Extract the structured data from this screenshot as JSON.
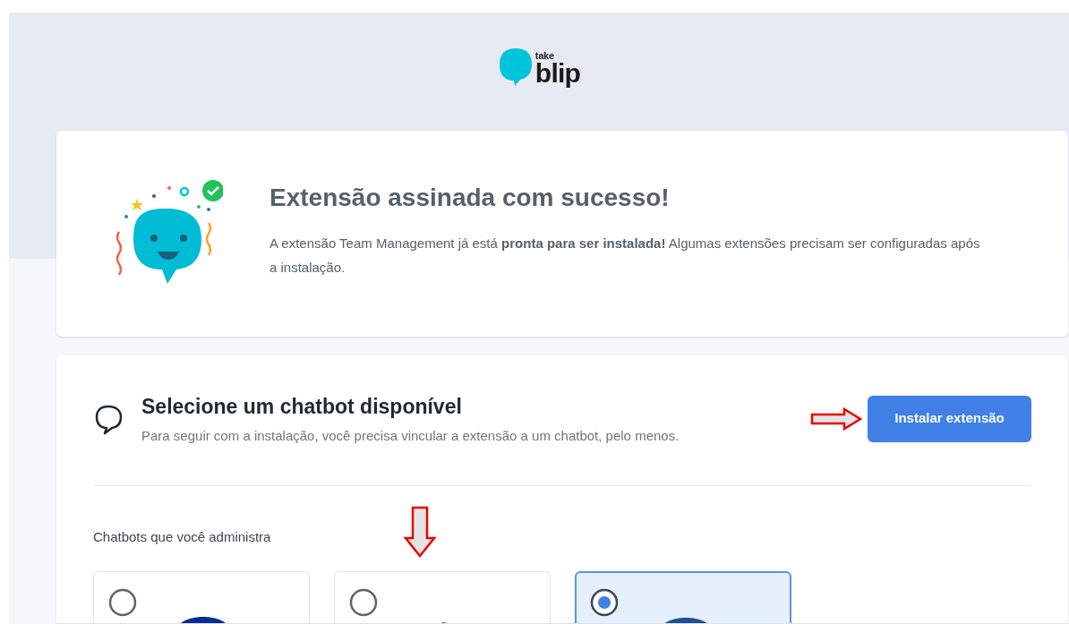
{
  "logo": {
    "small": "take",
    "large": "blip"
  },
  "success_card": {
    "title": "Extensão assinada com sucesso!",
    "message": "A extensão Team Management já está **pronta para ser instalada!** Algumas extensões precisam ser configuradas após a instalação."
  },
  "install_card": {
    "title": "Selecione um chatbot disponível",
    "subtitle": "Para seguir com a instalação, você precisa vincular a extensão a um chatbot, pelo menos.",
    "button": "Instalar extensão",
    "section_label": "Chatbots que você administra",
    "chatbots": [
      {
        "selected": false,
        "kind": "navy"
      },
      {
        "selected": false,
        "kind": "arrow"
      },
      {
        "selected": true,
        "kind": "blue"
      }
    ]
  }
}
